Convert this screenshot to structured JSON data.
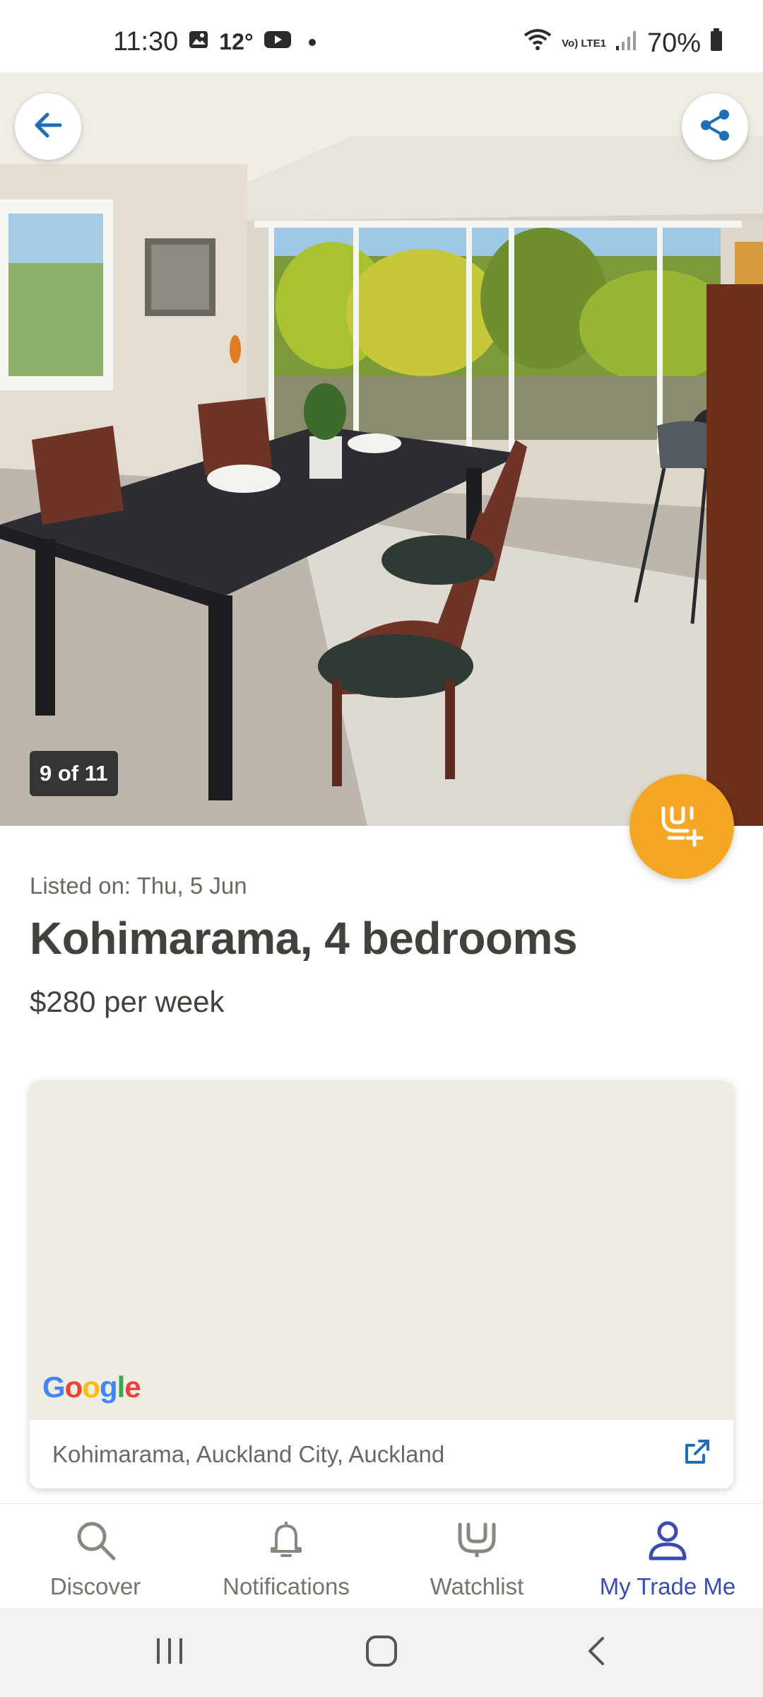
{
  "status_bar": {
    "time": "11:30",
    "temperature": "12°",
    "network": "Vo) LTE1",
    "battery": "70%",
    "icons": [
      "gallery-icon",
      "youtube-icon",
      "wifi-icon",
      "signal-icon",
      "battery-icon"
    ]
  },
  "photo": {
    "counter": "9 of 11",
    "icons": {
      "back": "arrow-left-icon",
      "share": "share-icon",
      "watchlist_add": "watchlist-add-icon"
    }
  },
  "listing": {
    "listed_on": "Listed on: Thu, 5 Jun",
    "title": "Kohimarama, 4 bedrooms",
    "price": "$280 per week"
  },
  "map": {
    "logo_text": "Google",
    "address": "Kohimarama, Auckland City, Auckland"
  },
  "bottom_nav": {
    "items": [
      {
        "label": "Discover",
        "icon": "search-icon",
        "active": false
      },
      {
        "label": "Notifications",
        "icon": "bell-icon",
        "active": false
      },
      {
        "label": "Watchlist",
        "icon": "watchlist-icon",
        "active": false
      },
      {
        "label": "My Trade Me",
        "icon": "user-icon",
        "active": true
      }
    ]
  },
  "colors": {
    "accent": "#3b4cb0",
    "fab": "#f5a623",
    "link_blue": "#1e6fb6",
    "text": "#44413c",
    "map_bg": "#efece4"
  }
}
